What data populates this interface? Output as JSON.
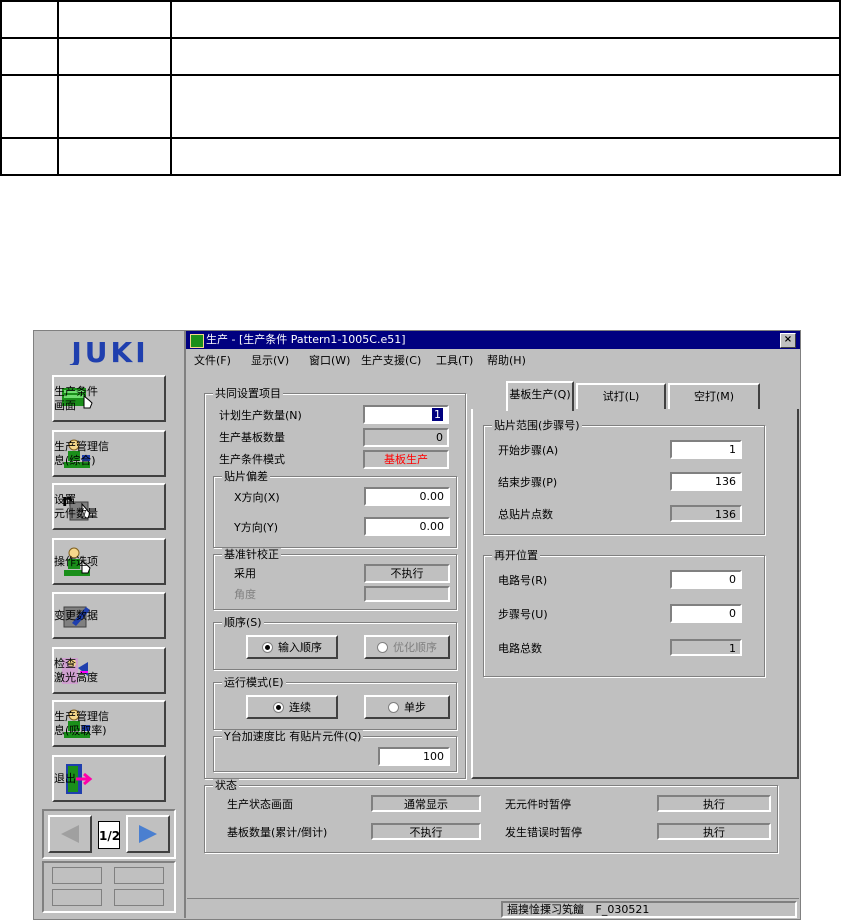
{
  "window": {
    "title": "生产 - [生产条件 Pattern1-1005C.e51]",
    "close_label": "×"
  },
  "menu": [
    "文件(F)",
    "显示(V)",
    "窗口(W)",
    "生产支援(C)",
    "工具(T)",
    "帮助(H)"
  ],
  "sidebar": {
    "logo": "JUKI",
    "buttons": [
      {
        "label": "生产条件\n画面"
      },
      {
        "label": "生产管理信\n息(综合)"
      },
      {
        "label": "设置\n元件数量"
      },
      {
        "label": "操作选项"
      },
      {
        "label": "变更数据"
      },
      {
        "label": "检查\n激光高度"
      },
      {
        "label": "生产管理信\n息(吸取率)"
      },
      {
        "label": "退出"
      }
    ],
    "page_indicator": "1/2"
  },
  "common": {
    "title": "共同设置项目",
    "plan_label": "计划生产数量(N)",
    "plan_value": "1",
    "boards_label": "生产基板数量",
    "boards_value": "0",
    "mode_label": "生产条件模式",
    "mode_value": "基板生产",
    "offset_title": "贴片偏差",
    "x_label": "X方向(X)",
    "x_value": "0.00",
    "y_label": "Y方向(Y)",
    "y_value": "0.00",
    "pin_title": "基准针校正",
    "adopt_label": "采用",
    "adopt_value": "不执行",
    "angle_label": "角度",
    "angle_value": "",
    "order_title": "顺序(S)",
    "order_input": "输入顺序",
    "order_opt": "优化顺序",
    "run_title": "运行模式(E)",
    "run_cont": "连续",
    "run_step": "单步",
    "accel_title": "Y台加速度比 有贴片元件(Q)",
    "accel_value": "100"
  },
  "tabs": [
    "基板生产(Q)",
    "试打(L)",
    "空打(M)"
  ],
  "range": {
    "title": "贴片范围(步骤号)",
    "start_label": "开始步骤(A)",
    "start_value": "1",
    "end_label": "结束步骤(P)",
    "end_value": "136",
    "total_label": "总贴片点数",
    "total_value": "136"
  },
  "restart": {
    "title": "再开位置",
    "circuit_label": "电路号(R)",
    "circuit_value": "0",
    "step_label": "步骤号(U)",
    "step_value": "0",
    "total_label": "电路总数",
    "total_value": "1"
  },
  "status": {
    "title": "状态",
    "screen_label": "生产状态画面",
    "screen_value": "通常显示",
    "nopart_label": "无元件时暂停",
    "nopart_value": "执行",
    "count_label": "基板数量(累计/倒计)",
    "count_value": "不执行",
    "error_label": "发生错误时暂停",
    "error_value": "执行"
  },
  "statusbar": {
    "text1": "揊搝惍搮习笂饘",
    "text2": "F_030521"
  },
  "colors": {
    "titlebar": "#000080",
    "mode_value": "#ff0000",
    "juki_blue": "#1f3fae",
    "selected_field": "#000080"
  }
}
